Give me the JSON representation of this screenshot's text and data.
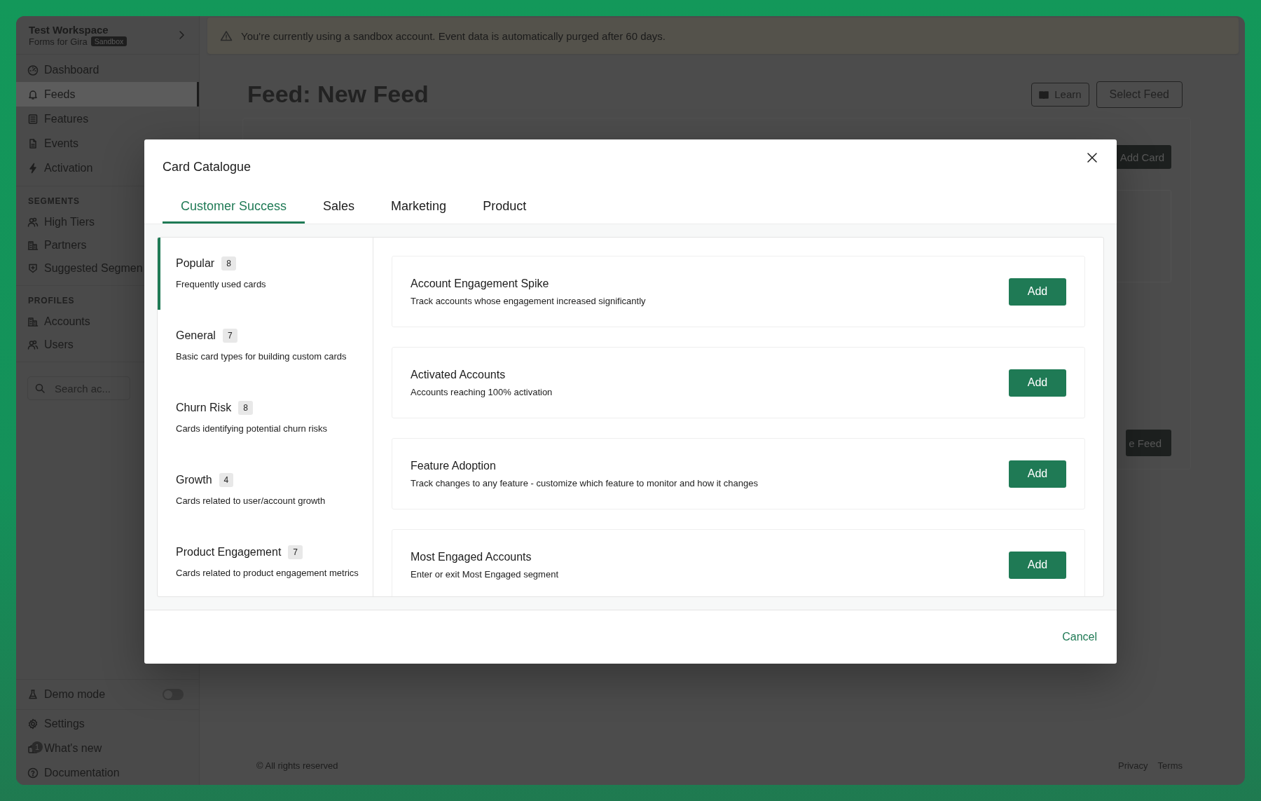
{
  "workspace": {
    "name": "Test Workspace",
    "subtitle": "Forms for Gira",
    "badge": "Sandbox"
  },
  "sidebar": {
    "nav": [
      {
        "label": "Dashboard",
        "selected": false
      },
      {
        "label": "Feeds",
        "selected": true
      },
      {
        "label": "Features",
        "selected": false
      },
      {
        "label": "Events",
        "selected": false
      },
      {
        "label": "Activation",
        "selected": false
      }
    ],
    "sections": [
      {
        "heading": "SEGMENTS",
        "items": [
          {
            "label": "High Tiers",
            "selected": false
          },
          {
            "label": "Partners",
            "selected": false
          },
          {
            "label": "Suggested Segmen",
            "selected": false
          }
        ]
      },
      {
        "heading": "PROFILES",
        "items": [
          {
            "label": "Accounts",
            "selected": false
          },
          {
            "label": "Users",
            "selected": false
          }
        ]
      }
    ],
    "search": {
      "placeholder": "Search ac..."
    },
    "bottom": [
      {
        "kind": "toggle",
        "label": "Demo mode",
        "on": false
      },
      {
        "kind": "link",
        "label": "Settings"
      },
      {
        "kind": "link",
        "label": "What's new",
        "badge": "1"
      },
      {
        "kind": "link",
        "label": "Documentation"
      }
    ]
  },
  "banner": "You're currently using a sandbox account. Event data is automatically purged after 60 days.",
  "page": {
    "title": "Feed: New Feed",
    "buttons": [
      {
        "label": "Learn",
        "kind": "icon"
      },
      {
        "label": "Select Feed",
        "kind": "plain"
      }
    ],
    "add_card": "Add Card",
    "save_feed": "e Feed"
  },
  "footer": {
    "copyright": "© All rights reserved",
    "links": [
      "Privacy",
      "Terms"
    ]
  },
  "modal": {
    "title": "Card Catalogue",
    "tabs": [
      {
        "label": "Customer Success",
        "selected": true
      },
      {
        "label": "Sales",
        "selected": false
      },
      {
        "label": "Marketing",
        "selected": false
      },
      {
        "label": "Product",
        "selected": false
      }
    ],
    "categories": [
      {
        "name": "Popular",
        "count": "8",
        "description": "Frequently used cards",
        "selected": true
      },
      {
        "name": "General",
        "count": "7",
        "description": "Basic card types for building custom cards",
        "selected": false
      },
      {
        "name": "Churn Risk",
        "count": "8",
        "description": "Cards identifying potential churn risks",
        "selected": false
      },
      {
        "name": "Growth",
        "count": "4",
        "description": "Cards related to user/account growth",
        "selected": false
      },
      {
        "name": "Product Engagement",
        "count": "7",
        "description": "Cards related to product engagement metrics",
        "selected": false
      }
    ],
    "cards": [
      {
        "title": "Account Engagement Spike",
        "description": "Track accounts whose engagement increased significantly",
        "button": "Add"
      },
      {
        "title": "Activated Accounts",
        "description": "Accounts reaching 100% activation",
        "button": "Add"
      },
      {
        "title": "Feature Adoption",
        "description": "Track changes to any feature - customize which feature to monitor and how it changes",
        "button": "Add"
      },
      {
        "title": "Most Engaged Accounts",
        "description": "Enter or exit Most Engaged segment",
        "button": "Add"
      }
    ],
    "cancel": "Cancel"
  }
}
